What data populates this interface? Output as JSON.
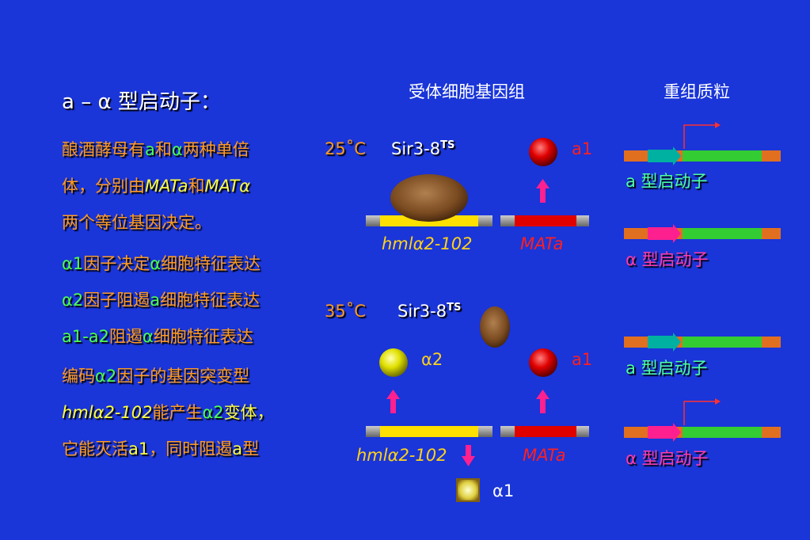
{
  "title": "a – α 型启动子：",
  "left_text": {
    "p1": {
      "a": "酿酒酵母有",
      "b": "a",
      "c": "和",
      "d": "α",
      "e": "两种单倍",
      "f": "体，分别由",
      "g": "MATa",
      "h": "和",
      "i": "MATα",
      "j": "两个等位基因决定。"
    },
    "p2": [
      {
        "g": "α1",
        "o": "因子决定",
        "g2": "α",
        "o2": "细胞特征表达"
      },
      {
        "g": "α2",
        "o": "因子阻遏",
        "g2": "a",
        "o2": "细胞特征表达"
      },
      {
        "g": "a1-a2",
        "o": "阻遏",
        "g2": "α",
        "o2": "细胞特征表达"
      }
    ],
    "p3": {
      "a": "编码",
      "b": "α2",
      "c": "因子的基因突变型",
      "d": "hmlα2-102",
      "e": "能产生",
      "f": "α2",
      "g": "变体，",
      "h": "它能灭活",
      "i": "a1",
      "j": "，同时阻遏",
      "k": "a",
      "l": "型"
    }
  },
  "headers": {
    "recipient": "受体细胞基因组",
    "plasmid": "重组质粒"
  },
  "top_panel": {
    "temp": "25˚C",
    "sir": "Sir3-8",
    "sir_sup": "TS",
    "a1_label": "a1",
    "gene_left": "hmlα2-102",
    "gene_right": "MATa"
  },
  "bottom_panel": {
    "temp": "35˚C",
    "sir": "Sir3-8",
    "sir_sup": "TS",
    "alpha2_label": "α2",
    "a1_label": "a1",
    "gene_left": "hmlα2-102",
    "gene_right": "MATa",
    "alpha1_label": "α1"
  },
  "plasmids": [
    {
      "label": "a 型启动子",
      "type": "a"
    },
    {
      "label": "α 型启动子",
      "type": "alpha"
    },
    {
      "label": "a 型启动子",
      "type": "a"
    },
    {
      "label": "α 型启动子",
      "type": "alpha"
    }
  ],
  "colors": {
    "background": "#1a35d8",
    "orange_text": "#ff9a1f",
    "green_text": "#4cff4c",
    "gene_yellow": "#ffe000",
    "gene_red": "#e00000",
    "plasmid_green": "#33cc33",
    "plasmid_orange": "#e07020",
    "arrow_teal": "#00b0a0",
    "arrow_pink": "#ff2090"
  }
}
